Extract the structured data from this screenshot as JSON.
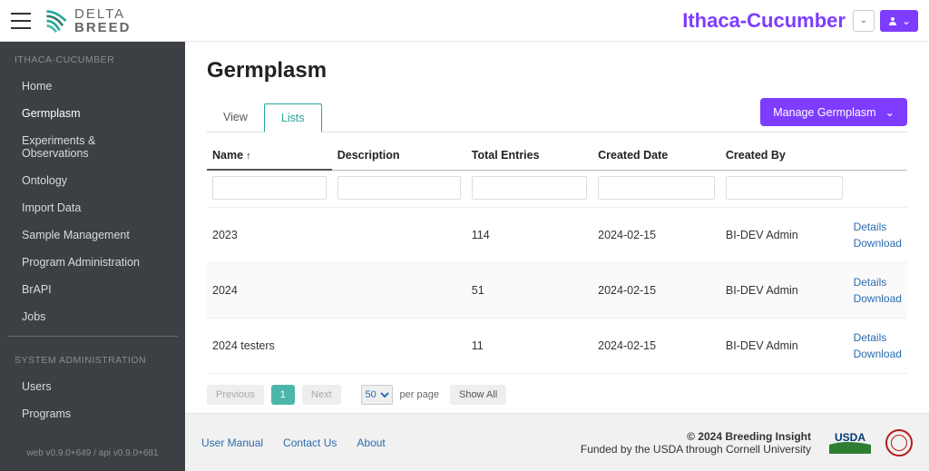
{
  "brand": {
    "line1": "DELTA",
    "line2": "BREED"
  },
  "program_name": "Ithaca-Cucumber",
  "sidebar": {
    "section1_label": "ITHACA-CUCUMBER",
    "items1": [
      "Home",
      "Germplasm",
      "Experiments & Observations",
      "Ontology",
      "Import Data",
      "Sample Management",
      "Program Administration",
      "BrAPI",
      "Jobs"
    ],
    "active_index": 1,
    "section2_label": "SYSTEM ADMINISTRATION",
    "items2": [
      "Users",
      "Programs"
    ],
    "version": "web v0.9.0+649 / api v0.9.0+681"
  },
  "page": {
    "title": "Germplasm",
    "tabs": [
      "View",
      "Lists"
    ],
    "active_tab": 1,
    "manage_button": "Manage Germplasm"
  },
  "table": {
    "columns": [
      "Name",
      "Description",
      "Total Entries",
      "Created Date",
      "Created By",
      ""
    ],
    "sort_col": 0,
    "sort_dir": "asc",
    "rows": [
      {
        "name": "2023",
        "description": "",
        "total": "114",
        "created": "2024-02-15",
        "by": "BI-DEV Admin"
      },
      {
        "name": "2024",
        "description": "",
        "total": "51",
        "created": "2024-02-15",
        "by": "BI-DEV Admin"
      },
      {
        "name": "2024 testers",
        "description": "",
        "total": "11",
        "created": "2024-02-15",
        "by": "BI-DEV Admin"
      }
    ],
    "action_labels": {
      "details": "Details",
      "download": "Download"
    }
  },
  "pager": {
    "prev": "Previous",
    "next": "Next",
    "current": "1",
    "per_page": "50",
    "per_page_label": "per page",
    "show_all": "Show All"
  },
  "footer": {
    "links": [
      "User Manual",
      "Contact Us",
      "About"
    ],
    "copyright": "© 2024 Breeding Insight",
    "funding": "Funded by the USDA through Cornell University"
  }
}
